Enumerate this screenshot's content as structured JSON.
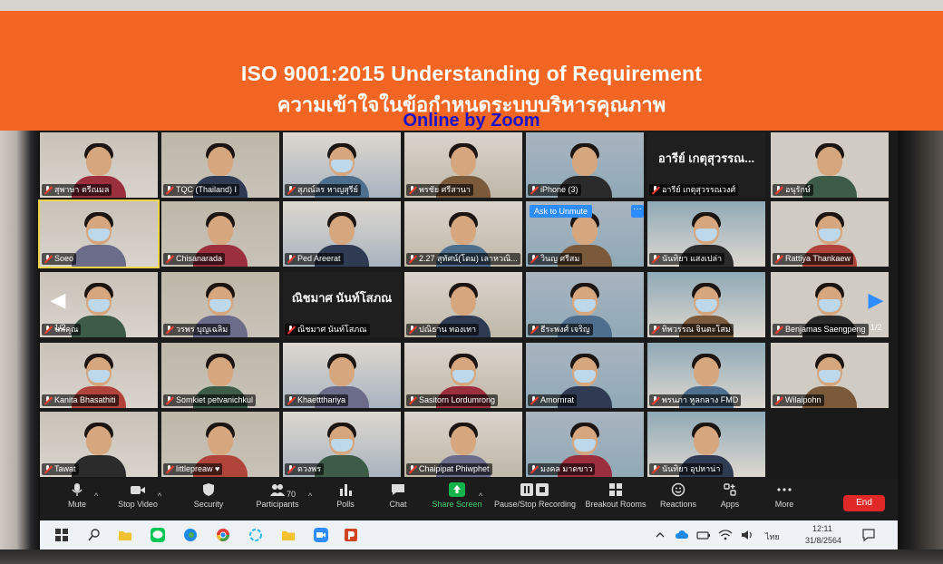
{
  "banner": {
    "title_en": "ISO 9001:2015 Understanding of Requirement",
    "title_th": "ความเข้าใจในข้อกำหนดระบบบริหารคุณภาพ",
    "subtitle": "Online by Zoom"
  },
  "gallery": {
    "page_indicator": "1/2",
    "ask_to_unmute_label": "Ask to Unmute",
    "ask_more_label": "···",
    "tiles": [
      {
        "name": "สุพาษา ตรีณมล",
        "display_text": ""
      },
      {
        "name": "TQC (Thailand) I",
        "display_text": ""
      },
      {
        "name": "สุภณ์ลร หาญสุรีย์",
        "display_text": ""
      },
      {
        "name": "พรชัย ศรีสานา",
        "display_text": ""
      },
      {
        "name": "iPhone (3)",
        "display_text": ""
      },
      {
        "name": "อารีย์ เกตุสุวรรณวงศ์",
        "display_text": "อารีย์ เกตุสุวรรณ..."
      },
      {
        "name": "อนุรักษ์",
        "display_text": ""
      },
      {
        "name": "Soeo",
        "display_text": ""
      },
      {
        "name": "Chisanarada",
        "display_text": ""
      },
      {
        "name": "Ped Areerat",
        "display_text": ""
      },
      {
        "name": "2.27 สุทัศน์(โดม) เลาหวณิ...",
        "display_text": ""
      },
      {
        "name": "วินญ ศรีสม",
        "display_text": ""
      },
      {
        "name": "นันทิยา แสงเปล่า",
        "display_text": ""
      },
      {
        "name": "Rattiya Thankaew",
        "display_text": ""
      },
      {
        "name": "นพคุณ",
        "display_text": ""
      },
      {
        "name": "วรพร บุญเฉลิม",
        "display_text": ""
      },
      {
        "name": "ณิชมาศ นันท์โสภณ",
        "display_text": "ณิชมาศ นันท์โสภณ"
      },
      {
        "name": "ปณิธาน ทองเทา",
        "display_text": ""
      },
      {
        "name": "ธีระพงศ์ เจริญ",
        "display_text": ""
      },
      {
        "name": "ทิพวรรณ จินตะโสม",
        "display_text": ""
      },
      {
        "name": "Benjamas Saengpeng",
        "display_text": ""
      },
      {
        "name": "Kanita Bhasathiti",
        "display_text": ""
      },
      {
        "name": "Somkiet petvanichkul",
        "display_text": ""
      },
      {
        "name": "Khaettthariya",
        "display_text": ""
      },
      {
        "name": "Sasitorn Lordumrong",
        "display_text": ""
      },
      {
        "name": "Amornrat",
        "display_text": ""
      },
      {
        "name": "พรนภา หูลกลาง FMD",
        "display_text": ""
      },
      {
        "name": "Wilaipohn",
        "display_text": ""
      },
      {
        "name": "Tawat",
        "display_text": ""
      },
      {
        "name": "littlepreaw ♥",
        "display_text": ""
      },
      {
        "name": "ดวงพร",
        "display_text": ""
      },
      {
        "name": "Chaipipat Phiwphet",
        "display_text": ""
      },
      {
        "name": "มงคล มาดขาว",
        "display_text": ""
      },
      {
        "name": "นันทิยา อุปหาน่า",
        "display_text": ""
      }
    ]
  },
  "toolbar": {
    "mute": "Mute",
    "stop_video": "Stop Video",
    "security": "Security",
    "participants": "Participants",
    "participants_count": "70",
    "polls": "Polls",
    "chat": "Chat",
    "share_screen": "Share Screen",
    "recording": "Pause/Stop Recording",
    "breakout": "Breakout Rooms",
    "reactions": "Reactions",
    "apps": "Apps",
    "more": "More",
    "end": "End",
    "caret": "^"
  },
  "taskbar": {
    "time": "12:11",
    "date": "31/8/2564",
    "language": "ไทย"
  },
  "colors": {
    "banner": "#f26522",
    "subtitle": "#1a12c9",
    "active_speaker": "#f1d44a",
    "end_button": "#e02828",
    "share_button": "#12b34a",
    "zoom_blue": "#2d8cff"
  }
}
